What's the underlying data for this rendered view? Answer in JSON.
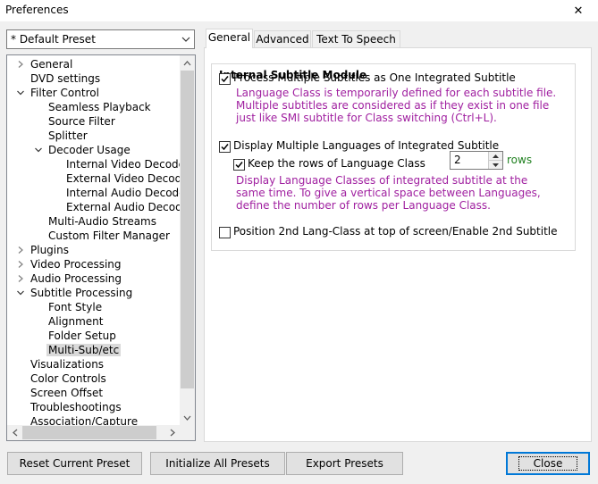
{
  "window": {
    "title": "Preferences",
    "close_glyph": "✕"
  },
  "preset_combo": {
    "value": "* Default Preset"
  },
  "tree": {
    "items": [
      {
        "label": "General",
        "level": 0,
        "toggle": "collapsed"
      },
      {
        "label": "DVD settings",
        "level": 0,
        "toggle": "none"
      },
      {
        "label": "Filter Control",
        "level": 0,
        "toggle": "expanded"
      },
      {
        "label": "Seamless Playback",
        "level": 1,
        "toggle": "none"
      },
      {
        "label": "Source Filter",
        "level": 1,
        "toggle": "none"
      },
      {
        "label": "Splitter",
        "level": 1,
        "toggle": "none"
      },
      {
        "label": "Decoder Usage",
        "level": 1,
        "toggle": "expanded"
      },
      {
        "label": "Internal Video Decoder",
        "level": 2,
        "toggle": "none"
      },
      {
        "label": "External Video Decoder",
        "level": 2,
        "toggle": "none"
      },
      {
        "label": "Internal Audio Decoder",
        "level": 2,
        "toggle": "none"
      },
      {
        "label": "External Audio Decoder",
        "level": 2,
        "toggle": "none"
      },
      {
        "label": "Multi-Audio Streams",
        "level": 1,
        "toggle": "none"
      },
      {
        "label": "Custom Filter Manager",
        "level": 1,
        "toggle": "none"
      },
      {
        "label": "Plugins",
        "level": 0,
        "toggle": "collapsed"
      },
      {
        "label": "Video Processing",
        "level": 0,
        "toggle": "collapsed"
      },
      {
        "label": "Audio Processing",
        "level": 0,
        "toggle": "collapsed"
      },
      {
        "label": "Subtitle Processing",
        "level": 0,
        "toggle": "expanded"
      },
      {
        "label": "Font Style",
        "level": 1,
        "toggle": "none"
      },
      {
        "label": "Alignment",
        "level": 1,
        "toggle": "none"
      },
      {
        "label": "Folder Setup",
        "level": 1,
        "toggle": "none"
      },
      {
        "label": "Multi-Sub/etc",
        "level": 1,
        "toggle": "none",
        "selected": true
      },
      {
        "label": "Visualizations",
        "level": 0,
        "toggle": "none"
      },
      {
        "label": "Color Controls",
        "level": 0,
        "toggle": "none"
      },
      {
        "label": "Screen Offset",
        "level": 0,
        "toggle": "none"
      },
      {
        "label": "Troubleshootings",
        "level": 0,
        "toggle": "none"
      },
      {
        "label": "Association/Capture",
        "level": 0,
        "toggle": "none"
      }
    ]
  },
  "tabs": [
    {
      "label": "General",
      "active": true
    },
    {
      "label": "Advanced",
      "active": false
    },
    {
      "label": "Text To Speech",
      "active": false
    }
  ],
  "group": {
    "title": "Internal Subtitle Module",
    "opt_process": {
      "label": "Process Multiple Subtitles as One Integrated Subtitle",
      "checked": true,
      "desc": [
        "Language Class is temporarily defined for each subtitle file.",
        "Multiple subtitles are considered as if they exist in one file",
        "just like SMI subtitle for Class switching (Ctrl+L)."
      ]
    },
    "opt_display": {
      "label": "Display Multiple Languages of Integrated Subtitle",
      "checked": true
    },
    "opt_keep": {
      "label": "Keep the rows of Language Class",
      "checked": true,
      "value": "2",
      "unit": "rows",
      "desc": [
        "Display Language Classes of integrated subtitle at the",
        "same time. To give a vertical space between Languages,",
        "define the number of rows per Language Class."
      ]
    },
    "opt_position": {
      "label": "Position 2nd Lang-Class at top of screen/Enable 2nd Subtitle",
      "checked": false
    }
  },
  "buttons": {
    "reset": {
      "label": "Reset Current Preset"
    },
    "init": {
      "label": "Initialize All Presets"
    },
    "export": {
      "label": "Export Presets"
    },
    "close": {
      "label": "Close"
    }
  },
  "colors": {
    "desc_text": "#a020a0",
    "rows_unit": "#208020",
    "focus_border": "#0078d7"
  }
}
